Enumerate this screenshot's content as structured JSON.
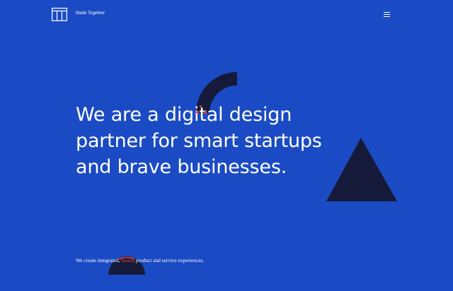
{
  "header": {
    "logo_icon": "made-together-logo-icon",
    "brand_name": "Made Together",
    "menu_icon": "hamburger-menu-icon"
  },
  "hero": {
    "headline_lines": [
      "We are a digital design",
      "partner for smart startups",
      "and brave businesses."
    ]
  },
  "tagline": {
    "before": "We create integrated, ",
    "highlight": "brand,",
    "after": " product and service experiences."
  },
  "colors": {
    "background": "#1b4bc4",
    "text": "#ffffff",
    "shape_dark": "#161a3a",
    "accent": "#e5443f"
  },
  "decorations": [
    "quarter-arc-shape",
    "triangle-shape",
    "half-circle-shape"
  ]
}
